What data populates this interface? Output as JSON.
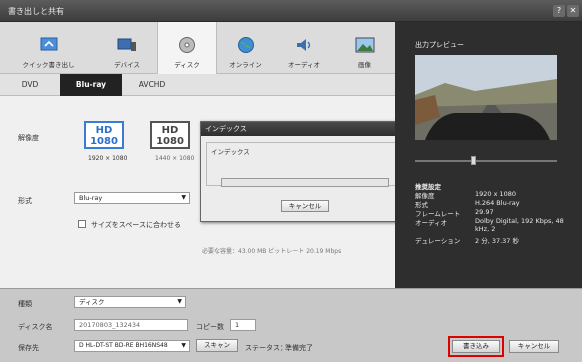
{
  "window": {
    "title": "書き出しと共有",
    "help_label": "?",
    "close_label": "✕"
  },
  "tabs": [
    {
      "label": "クイック書き出し",
      "icon": "quick-export-icon"
    },
    {
      "label": "デバイス",
      "icon": "device-icon"
    },
    {
      "label": "ディスク",
      "icon": "disc-icon",
      "active": true
    },
    {
      "label": "オンライン",
      "icon": "globe-icon"
    },
    {
      "label": "オーディオ",
      "icon": "speaker-icon"
    },
    {
      "label": "画像",
      "icon": "image-icon"
    }
  ],
  "subtabs": [
    {
      "label": "DVD"
    },
    {
      "label": "Blu-ray",
      "active": true
    },
    {
      "label": "AVCHD"
    }
  ],
  "resolution": {
    "label": "解像度",
    "options": [
      {
        "line1": "HD",
        "line2": "1080",
        "caption": "1920 × 1080",
        "selected": true
      },
      {
        "line1": "HD",
        "line2": "1080",
        "caption": "1440 × 1080",
        "selected": false
      }
    ]
  },
  "format": {
    "label": "形式",
    "value": "Blu-ray"
  },
  "fit_checkbox": {
    "label": "サイズをスペースに合わせる",
    "checked": false
  },
  "hidden_text": "必要な容量：43.00 MB ビットレート 20.19 Mbps",
  "dialog": {
    "title": "インデックス",
    "close_label": "x",
    "group_label": "インデックス",
    "progress": 0,
    "cancel_label": "キャンセル"
  },
  "preview": {
    "title": "出力プレビュー",
    "settings_title": "推奨設定",
    "rows": [
      {
        "label": "解像度",
        "value": "1920 x 1080"
      },
      {
        "label": "形式",
        "value": "H.264 Blu-ray"
      },
      {
        "label": "フレームレート",
        "value": "29.97"
      },
      {
        "label": "オーディオ",
        "value": "Dolby Digital, 192 Kbps, 48 kHz, 2"
      },
      {
        "label": "デュレーション",
        "value": "2 分, 37.37 秒"
      }
    ]
  },
  "bottom": {
    "type_label": "種類",
    "type_value": "ディスク",
    "disc_name_label": "ディスク名",
    "disc_name_value": "20170803_132434",
    "copies_label": "コピー数",
    "copies_value": "1",
    "destination_label": "保存先",
    "destination_value": "D HL-DT-ST BD-RE BH16NS48",
    "scan_label": "スキャン",
    "status_label": "ステータス：",
    "status_value": "準備完了",
    "write_label": "書き込み",
    "cancel_label": "キャンセル"
  },
  "colors": {
    "accent_blue": "#3a7bd5",
    "highlight_red": "#e00000",
    "selected_tab": "#222222"
  }
}
